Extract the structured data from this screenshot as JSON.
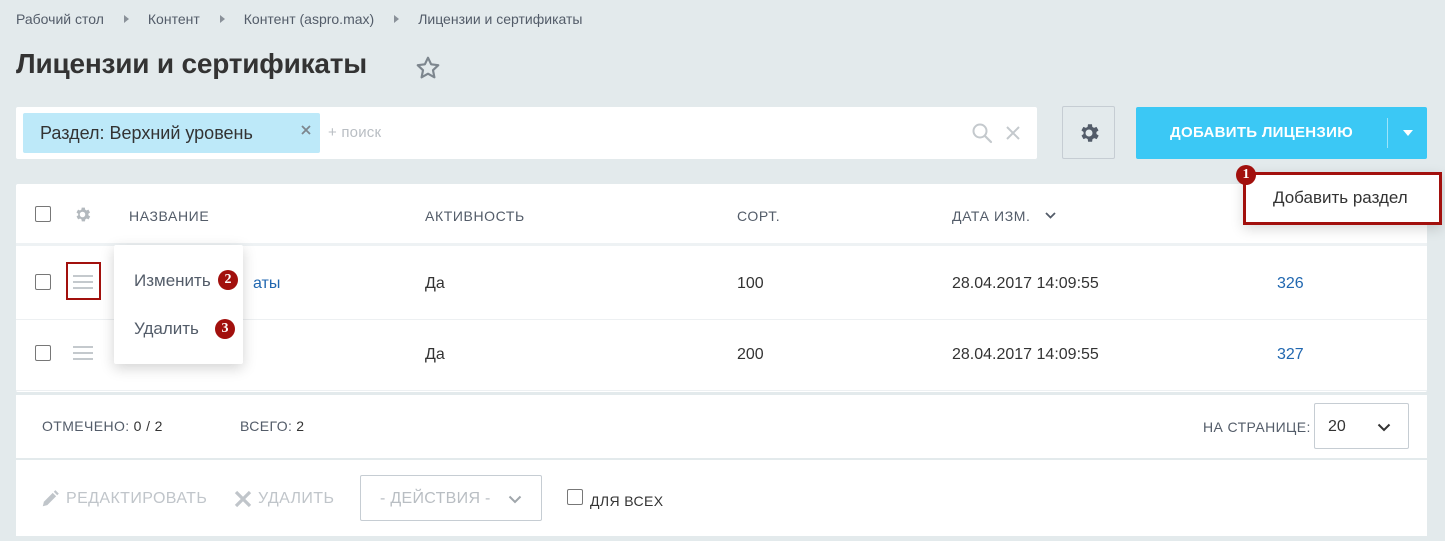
{
  "breadcrumb": [
    "Рабочий стол",
    "Контент",
    "Контент (aspro.max)",
    "Лицензии и сертификаты"
  ],
  "page_title": "Лицензии и сертификаты",
  "filter": {
    "chip_label": "Раздел: Верхний уровень",
    "search_placeholder": "+ поиск"
  },
  "add_button": {
    "label": "ДОБАВИТЬ ЛИЦЕНЗИЮ"
  },
  "dropdown": {
    "item": "Добавить раздел",
    "badge": "1"
  },
  "table": {
    "columns": [
      "НАЗВАНИЕ",
      "АКТИВНОСТЬ",
      "СОРТ.",
      "ДАТА ИЗМ."
    ],
    "rows": [
      {
        "name_fragment": "аты",
        "active": "Да",
        "sort": "100",
        "date": "28.04.2017 14:09:55",
        "id": "326"
      },
      {
        "active": "Да",
        "sort": "200",
        "date": "28.04.2017 14:09:55",
        "id": "327"
      }
    ]
  },
  "context_menu": {
    "items": [
      {
        "label": "Изменить",
        "badge": "2"
      },
      {
        "label": "Удалить",
        "badge": "3"
      }
    ]
  },
  "footer": {
    "selected_label": "ОТМЕЧЕНО:",
    "selected_value": "0 / 2",
    "total_label": "ВСЕГО:",
    "total_value": "2",
    "per_page_label": "НА СТРАНИЦЕ:",
    "per_page_value": "20"
  },
  "actions": {
    "edit": "РЕДАКТИРОВАТЬ",
    "delete": "УДАЛИТЬ",
    "select_label": "- ДЕЙСТВИЯ -",
    "for_all": "ДЛЯ ВСЕХ"
  },
  "colors": {
    "accent": "#3bc8f5",
    "chip": "#bde9f9",
    "highlight": "#a2100d",
    "link": "#2067b0"
  }
}
